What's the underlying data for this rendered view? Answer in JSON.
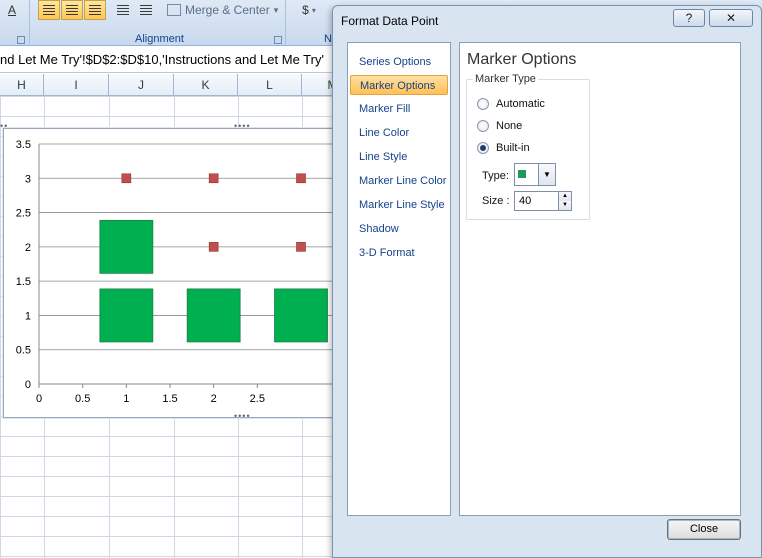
{
  "ribbon": {
    "merge_label": "Merge & Center",
    "merge_chevron": "▾",
    "alignment_label": "Alignment",
    "number_glyph": "$",
    "number_label": "N",
    "font_color_glyph": "A"
  },
  "formula_bar": {
    "text": "nd Let Me Try'!$D$2:$D$10,'Instructions and Let Me Try'"
  },
  "columns": [
    "H",
    "I",
    "J",
    "K",
    "L",
    "M"
  ],
  "chart_data": {
    "type": "scatter",
    "title": "",
    "xlabel": "",
    "ylabel": "",
    "xlim": [
      0,
      3
    ],
    "ylim": [
      0,
      3.5
    ],
    "x_ticks": [
      "0",
      "0.5",
      "1",
      "1.5",
      "2",
      "2.5"
    ],
    "y_ticks": [
      "0",
      "0.5",
      "1",
      "1.5",
      "2",
      "2.5",
      "3",
      "3.5"
    ],
    "grid": "horizontal",
    "series": [
      {
        "marker": "small-square",
        "color": "#c0504d",
        "points": [
          [
            1,
            3
          ],
          [
            2,
            3
          ],
          [
            3,
            3
          ],
          [
            2,
            2
          ],
          [
            3,
            2
          ]
        ]
      },
      {
        "marker": "large-square",
        "color": "#00b050",
        "points": [
          [
            1,
            2
          ],
          [
            1,
            1
          ],
          [
            2,
            1
          ],
          [
            3,
            1
          ]
        ]
      }
    ]
  },
  "dialog": {
    "title": "Format Data Point",
    "help_glyph": "?",
    "close_glyph": "✕",
    "nav": [
      "Series Options",
      "Marker Options",
      "Marker Fill",
      "Line Color",
      "Line Style",
      "Marker Line Color",
      "Marker Line Style",
      "Shadow",
      "3-D Format"
    ],
    "selected_nav": "Marker Options",
    "content_title": "Marker Options",
    "marker_type_label": "Marker Type",
    "options": [
      "Automatic",
      "None",
      "Built-in"
    ],
    "selected_option": "Built-in",
    "type_label": "Type:",
    "type_marker_color": "#1f9a5a",
    "type_dropdown_glyph": "▼",
    "size_label": "Size :",
    "size_value": "40",
    "spin_up_glyph": "▲",
    "spin_down_glyph": "▼",
    "close_button": "Close"
  }
}
